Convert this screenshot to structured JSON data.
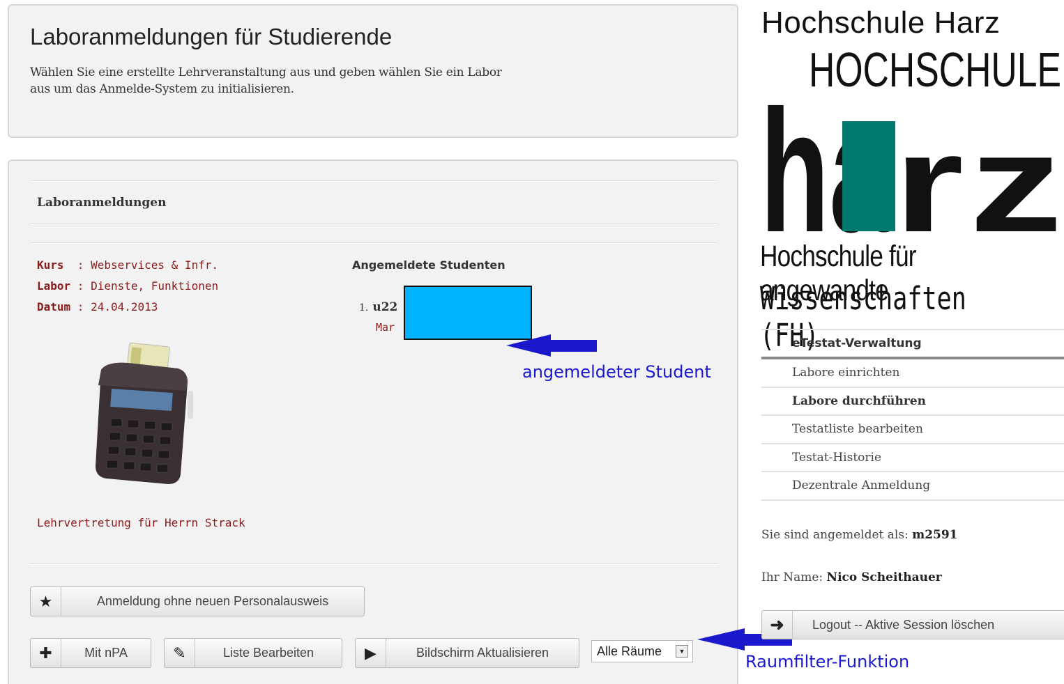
{
  "intro": {
    "title": "Laboranmeldungen für Studierende",
    "text": "Wählen Sie eine erstellte Lehrveranstaltung aus und geben wählen Sie ein Labor aus um das Anmelde-System zu initialisieren."
  },
  "main": {
    "heading": "Laboranmeldungen",
    "info": [
      {
        "key": "Kurs ",
        "value": " : Webservices & Infr."
      },
      {
        "key": "Labor",
        "value": " : Dienste, Funktionen"
      },
      {
        "key": "Datum",
        "value": " : 24.04.2013"
      }
    ],
    "students_heading": "Angemeldete Studenten",
    "student": {
      "num": "1.",
      "uid": "u22",
      "sub": "Mar"
    },
    "footer_note": "Lehrvertretung für Herrn Strack",
    "buttons": {
      "no_id": "Anmeldung ohne neuen Personalausweis",
      "npa": "Mit nPA",
      "edit_list": "Liste Bearbeiten",
      "refresh": "Bildschirm Aktualisieren"
    },
    "room_filter": {
      "selected": "Alle Räume"
    }
  },
  "logo": {
    "top": "Hochschule Harz",
    "mark_top": "HOCHSCHULE",
    "mark_ha": "ha",
    "mark_r": "r",
    "mark_z": "z",
    "sub1": "Hochschule für angewandte",
    "sub2": "Wissenschaften (FH)",
    "colors": {
      "black": "#111111",
      "teal": "#007a6e"
    }
  },
  "nav": {
    "heading": "eTestat-Verwaltung",
    "items": [
      {
        "label": "Labore einrichten",
        "active": false
      },
      {
        "label": "Labore durchführen",
        "active": true
      },
      {
        "label": "Testatliste bearbeiten",
        "active": false
      },
      {
        "label": "Testat-Historie",
        "active": false
      },
      {
        "label": "Dezentrale Anmeldung",
        "active": false
      }
    ]
  },
  "user": {
    "login_label": "Sie sind angemeldet als: ",
    "login_value": "m2591",
    "name_label": "Ihr Name: ",
    "name_value": "Nico Scheithauer",
    "logout_label": "Logout -- Aktive Session löschen"
  },
  "annotations": {
    "student": "angemeldeter Student",
    "filter": "Raumfilter-Funktion",
    "color": "#1a1acc"
  }
}
